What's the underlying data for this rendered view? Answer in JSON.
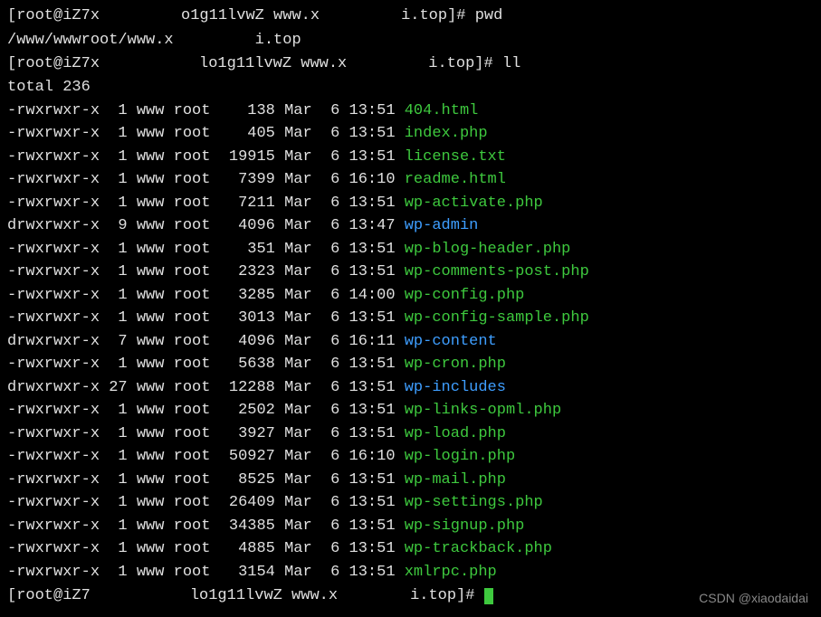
{
  "prompt1": {
    "prefix": "[root@iZ7x",
    "mid": "o1g11lvwZ www.x",
    "suffix": "i.top]# ",
    "cmd": "pwd"
  },
  "pwd_output": {
    "prefix": "/www/wwwroot/www.x",
    "suffix": "i.top"
  },
  "prompt2": {
    "prefix": "[root@iZ7x",
    "mid": "lo1g11lvwZ www.x",
    "suffix": "i.top]# ",
    "cmd": "ll"
  },
  "total": "total 236",
  "files": [
    {
      "perms": "-rwxrwxr-x",
      "links": " 1",
      "owner": "www",
      "group": "root",
      "size": "   138",
      "month": "Mar",
      "day": " 6",
      "time": "13:51",
      "name": "404.html",
      "type": "file"
    },
    {
      "perms": "-rwxrwxr-x",
      "links": " 1",
      "owner": "www",
      "group": "root",
      "size": "   405",
      "month": "Mar",
      "day": " 6",
      "time": "13:51",
      "name": "index.php",
      "type": "file"
    },
    {
      "perms": "-rwxrwxr-x",
      "links": " 1",
      "owner": "www",
      "group": "root",
      "size": " 19915",
      "month": "Mar",
      "day": " 6",
      "time": "13:51",
      "name": "license.txt",
      "type": "file"
    },
    {
      "perms": "-rwxrwxr-x",
      "links": " 1",
      "owner": "www",
      "group": "root",
      "size": "  7399",
      "month": "Mar",
      "day": " 6",
      "time": "16:10",
      "name": "readme.html",
      "type": "file"
    },
    {
      "perms": "-rwxrwxr-x",
      "links": " 1",
      "owner": "www",
      "group": "root",
      "size": "  7211",
      "month": "Mar",
      "day": " 6",
      "time": "13:51",
      "name": "wp-activate.php",
      "type": "file"
    },
    {
      "perms": "drwxrwxr-x",
      "links": " 9",
      "owner": "www",
      "group": "root",
      "size": "  4096",
      "month": "Mar",
      "day": " 6",
      "time": "13:47",
      "name": "wp-admin",
      "type": "dir"
    },
    {
      "perms": "-rwxrwxr-x",
      "links": " 1",
      "owner": "www",
      "group": "root",
      "size": "   351",
      "month": "Mar",
      "day": " 6",
      "time": "13:51",
      "name": "wp-blog-header.php",
      "type": "file"
    },
    {
      "perms": "-rwxrwxr-x",
      "links": " 1",
      "owner": "www",
      "group": "root",
      "size": "  2323",
      "month": "Mar",
      "day": " 6",
      "time": "13:51",
      "name": "wp-comments-post.php",
      "type": "file"
    },
    {
      "perms": "-rwxrwxr-x",
      "links": " 1",
      "owner": "www",
      "group": "root",
      "size": "  3285",
      "month": "Mar",
      "day": " 6",
      "time": "14:00",
      "name": "wp-config.php",
      "type": "file"
    },
    {
      "perms": "-rwxrwxr-x",
      "links": " 1",
      "owner": "www",
      "group": "root",
      "size": "  3013",
      "month": "Mar",
      "day": " 6",
      "time": "13:51",
      "name": "wp-config-sample.php",
      "type": "file"
    },
    {
      "perms": "drwxrwxr-x",
      "links": " 7",
      "owner": "www",
      "group": "root",
      "size": "  4096",
      "month": "Mar",
      "day": " 6",
      "time": "16:11",
      "name": "wp-content",
      "type": "dir"
    },
    {
      "perms": "-rwxrwxr-x",
      "links": " 1",
      "owner": "www",
      "group": "root",
      "size": "  5638",
      "month": "Mar",
      "day": " 6",
      "time": "13:51",
      "name": "wp-cron.php",
      "type": "file"
    },
    {
      "perms": "drwxrwxr-x",
      "links": "27",
      "owner": "www",
      "group": "root",
      "size": " 12288",
      "month": "Mar",
      "day": " 6",
      "time": "13:51",
      "name": "wp-includes",
      "type": "dir"
    },
    {
      "perms": "-rwxrwxr-x",
      "links": " 1",
      "owner": "www",
      "group": "root",
      "size": "  2502",
      "month": "Mar",
      "day": " 6",
      "time": "13:51",
      "name": "wp-links-opml.php",
      "type": "file"
    },
    {
      "perms": "-rwxrwxr-x",
      "links": " 1",
      "owner": "www",
      "group": "root",
      "size": "  3927",
      "month": "Mar",
      "day": " 6",
      "time": "13:51",
      "name": "wp-load.php",
      "type": "file"
    },
    {
      "perms": "-rwxrwxr-x",
      "links": " 1",
      "owner": "www",
      "group": "root",
      "size": " 50927",
      "month": "Mar",
      "day": " 6",
      "time": "16:10",
      "name": "wp-login.php",
      "type": "file"
    },
    {
      "perms": "-rwxrwxr-x",
      "links": " 1",
      "owner": "www",
      "group": "root",
      "size": "  8525",
      "month": "Mar",
      "day": " 6",
      "time": "13:51",
      "name": "wp-mail.php",
      "type": "file"
    },
    {
      "perms": "-rwxrwxr-x",
      "links": " 1",
      "owner": "www",
      "group": "root",
      "size": " 26409",
      "month": "Mar",
      "day": " 6",
      "time": "13:51",
      "name": "wp-settings.php",
      "type": "file"
    },
    {
      "perms": "-rwxrwxr-x",
      "links": " 1",
      "owner": "www",
      "group": "root",
      "size": " 34385",
      "month": "Mar",
      "day": " 6",
      "time": "13:51",
      "name": "wp-signup.php",
      "type": "file"
    },
    {
      "perms": "-rwxrwxr-x",
      "links": " 1",
      "owner": "www",
      "group": "root",
      "size": "  4885",
      "month": "Mar",
      "day": " 6",
      "time": "13:51",
      "name": "wp-trackback.php",
      "type": "file"
    },
    {
      "perms": "-rwxrwxr-x",
      "links": " 1",
      "owner": "www",
      "group": "root",
      "size": "  3154",
      "month": "Mar",
      "day": " 6",
      "time": "13:51",
      "name": "xmlrpc.php",
      "type": "file"
    }
  ],
  "prompt3": {
    "prefix": "[root@iZ7",
    "mid": "lo1g11lvwZ www.x",
    "suffix": "i.top]# "
  },
  "watermark": "CSDN @xiaodaidai"
}
